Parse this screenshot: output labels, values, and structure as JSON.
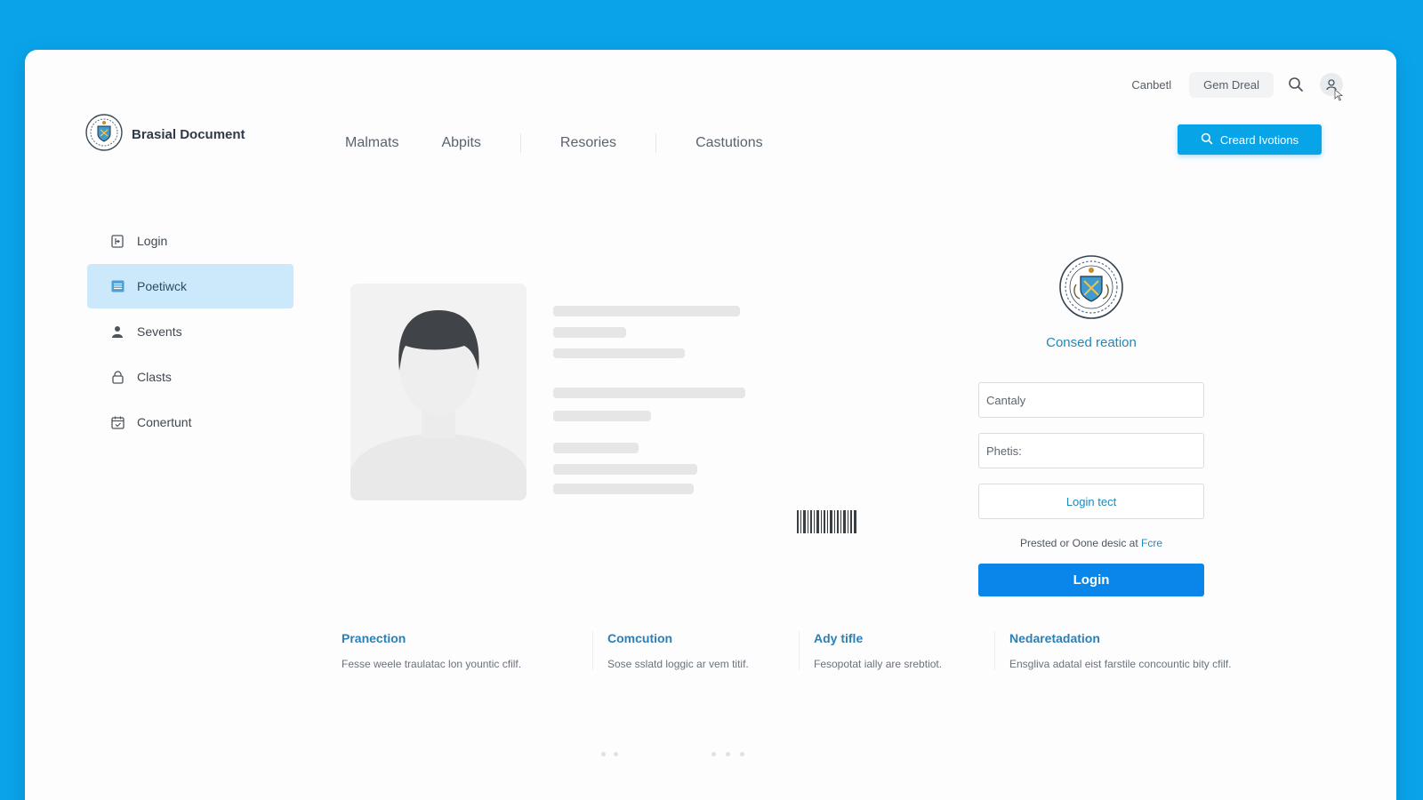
{
  "brand": {
    "name": "Brasial Document",
    "logo": "crest-seal-icon"
  },
  "top_bar": {
    "link": "Canbetl",
    "chip": "Gem Dreal",
    "icons": [
      "search-icon",
      "user-avatar-icon"
    ]
  },
  "nav": {
    "items": [
      "Malmats",
      "Abpits",
      "Resories",
      "Castutions"
    ]
  },
  "cta": {
    "label": "Creard Ivotions",
    "icon": "search-icon"
  },
  "sidebar": {
    "items": [
      {
        "label": "Login",
        "icon": "login-door-icon",
        "active": false
      },
      {
        "label": "Poetiwck",
        "icon": "list-icon",
        "active": true
      },
      {
        "label": "Sevents",
        "icon": "person-icon",
        "active": false
      },
      {
        "label": "Clasts",
        "icon": "lock-icon",
        "active": false
      },
      {
        "label": "Conertunt",
        "icon": "calendar-icon",
        "active": false
      }
    ]
  },
  "login": {
    "title": "Consed reation",
    "seal": "crest-seal-icon",
    "field1_placeholder": "Cantaly",
    "field2_placeholder": "Phetis:",
    "text_button": "Login tect",
    "hint_prefix": "Prested or Oone desic at",
    "hint_link": "Fcre",
    "button": "Login"
  },
  "features": [
    {
      "title": "Pranection",
      "desc": "Fesse weele traulatac lon yountic cfilf."
    },
    {
      "title": "Comcution",
      "desc": "Sose sslatd loggic ar vem titif."
    },
    {
      "title": "Ady tifle",
      "desc": "Fesopotat ially are srebtiot."
    },
    {
      "title": "Nedaretadation",
      "desc": "Ensgliva adatal eist farstile concountic bity cfilf."
    }
  ],
  "colors": {
    "background": "#0aa3ea",
    "accent": "#08a4e8",
    "primary_button": "#0a86ea",
    "sidebar_active": "#cbe9fb"
  }
}
